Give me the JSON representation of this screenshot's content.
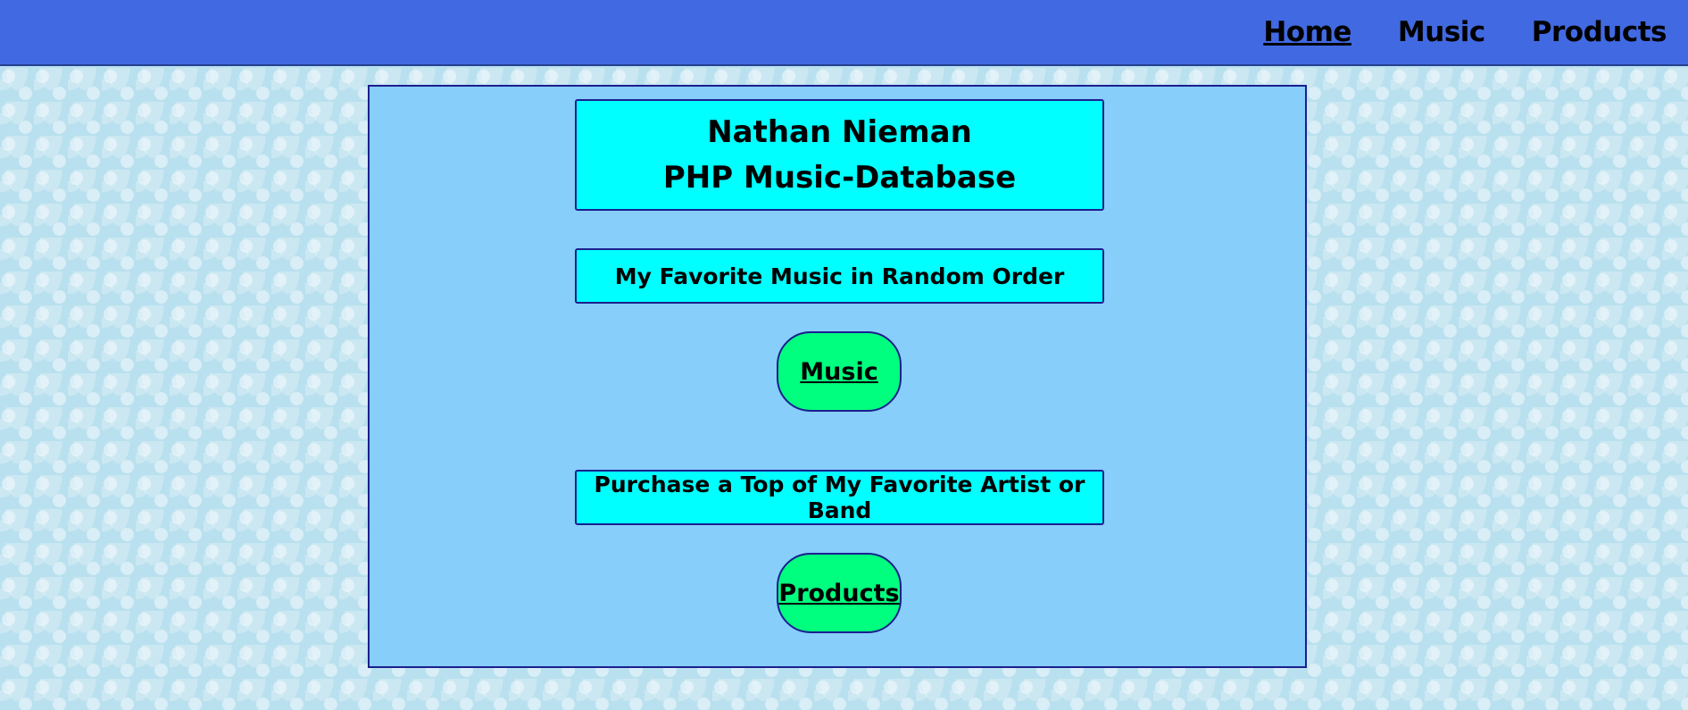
{
  "nav": {
    "items": [
      {
        "label": "Home",
        "active": true
      },
      {
        "label": "Music",
        "active": false
      },
      {
        "label": "Products",
        "active": false
      }
    ]
  },
  "main": {
    "title_line1": "Nathan Nieman",
    "title_line2": "PHP Music-Database",
    "music_section_heading": "My Favorite Music in Random Order",
    "music_button_label": "Music",
    "products_section_heading": "Purchase a Top of My Favorite Artist or Band",
    "products_button_label": "Products"
  },
  "colors": {
    "header_bar": "#4169e1",
    "panel": "#87cefa",
    "heading_box": "#00ffff",
    "button": "#00ff7f",
    "border": "#1b1f8f",
    "page_background": "#b9e0ee"
  }
}
